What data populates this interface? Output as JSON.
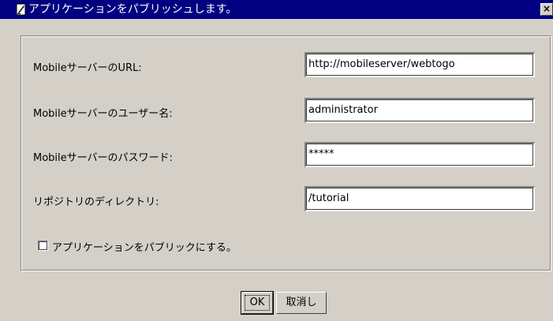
{
  "window": {
    "title": "アプリケーションをパブリッシュします。",
    "close_label": "×"
  },
  "form": {
    "fields": [
      {
        "label": "MobileサーバーのURL:",
        "value": "http://mobileserver/webtogo"
      },
      {
        "label": "Mobileサーバーのユーザー名:",
        "value": "administrator"
      },
      {
        "label": "Mobileサーバーのパスワード:",
        "value": "*****"
      },
      {
        "label": "リポジトリのディレクトリ:",
        "value": "/tutorial"
      }
    ],
    "public_checkbox": {
      "label": "アプリケーションをパブリックにする。",
      "checked": false
    }
  },
  "buttons": {
    "ok_label": "OK",
    "cancel_label": "取消し"
  }
}
